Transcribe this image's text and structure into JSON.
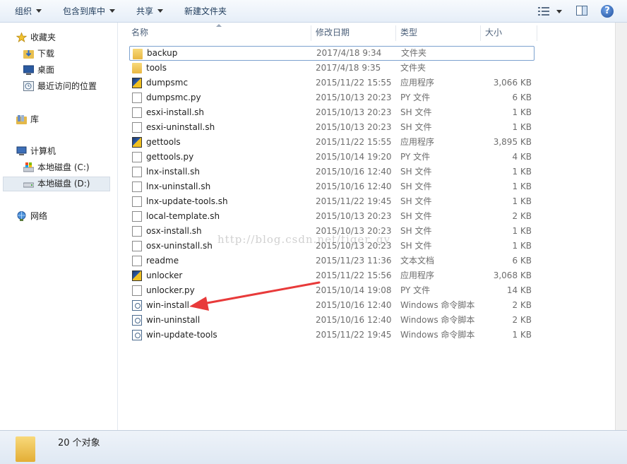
{
  "toolbar": {
    "organize": "组织",
    "include_library": "包含到库中",
    "share": "共享",
    "new_folder": "新建文件夹",
    "help": "?"
  },
  "nav": {
    "favorites": "收藏夹",
    "downloads": "下载",
    "desktop": "桌面",
    "recent": "最近访问的位置",
    "libraries": "库",
    "computer": "计算机",
    "drive_c": "本地磁盘 (C:)",
    "drive_d": "本地磁盘 (D:)",
    "network": "网络"
  },
  "columns": {
    "name": "名称",
    "date": "修改日期",
    "type": "类型",
    "size": "大小"
  },
  "files": [
    {
      "name": "backup",
      "date": "2017/4/18 9:34",
      "type": "文件夹",
      "size": "",
      "icon": "folder-icon"
    },
    {
      "name": "tools",
      "date": "2017/4/18 9:35",
      "type": "文件夹",
      "size": "",
      "icon": "folder-icon"
    },
    {
      "name": "dumpsmc",
      "date": "2015/11/22 15:55",
      "type": "应用程序",
      "size": "3,066 KB",
      "icon": "application-icon"
    },
    {
      "name": "dumpsmc.py",
      "date": "2015/10/13 20:23",
      "type": "PY 文件",
      "size": "6 KB",
      "icon": "document-icon"
    },
    {
      "name": "esxi-install.sh",
      "date": "2015/10/13 20:23",
      "type": "SH 文件",
      "size": "1 KB",
      "icon": "document-icon"
    },
    {
      "name": "esxi-uninstall.sh",
      "date": "2015/10/13 20:23",
      "type": "SH 文件",
      "size": "1 KB",
      "icon": "document-icon"
    },
    {
      "name": "gettools",
      "date": "2015/11/22 15:55",
      "type": "应用程序",
      "size": "3,895 KB",
      "icon": "application-icon"
    },
    {
      "name": "gettools.py",
      "date": "2015/10/14 19:20",
      "type": "PY 文件",
      "size": "4 KB",
      "icon": "document-icon"
    },
    {
      "name": "lnx-install.sh",
      "date": "2015/10/16 12:40",
      "type": "SH 文件",
      "size": "1 KB",
      "icon": "document-icon"
    },
    {
      "name": "lnx-uninstall.sh",
      "date": "2015/10/16 12:40",
      "type": "SH 文件",
      "size": "1 KB",
      "icon": "document-icon"
    },
    {
      "name": "lnx-update-tools.sh",
      "date": "2015/11/22 19:45",
      "type": "SH 文件",
      "size": "1 KB",
      "icon": "document-icon"
    },
    {
      "name": "local-template.sh",
      "date": "2015/10/13 20:23",
      "type": "SH 文件",
      "size": "2 KB",
      "icon": "document-icon"
    },
    {
      "name": "osx-install.sh",
      "date": "2015/10/13 20:23",
      "type": "SH 文件",
      "size": "1 KB",
      "icon": "document-icon"
    },
    {
      "name": "osx-uninstall.sh",
      "date": "2015/10/13 20:23",
      "type": "SH 文件",
      "size": "1 KB",
      "icon": "document-icon"
    },
    {
      "name": "readme",
      "date": "2015/11/23 11:36",
      "type": "文本文档",
      "size": "6 KB",
      "icon": "text-document-icon"
    },
    {
      "name": "unlocker",
      "date": "2015/11/22 15:56",
      "type": "应用程序",
      "size": "3,068 KB",
      "icon": "application-icon"
    },
    {
      "name": "unlocker.py",
      "date": "2015/10/14 19:08",
      "type": "PY 文件",
      "size": "14 KB",
      "icon": "document-icon"
    },
    {
      "name": "win-install",
      "date": "2015/10/16 12:40",
      "type": "Windows 命令脚本",
      "size": "2 KB",
      "icon": "batch-script-icon"
    },
    {
      "name": "win-uninstall",
      "date": "2015/10/16 12:40",
      "type": "Windows 命令脚本",
      "size": "2 KB",
      "icon": "batch-script-icon"
    },
    {
      "name": "win-update-tools",
      "date": "2015/11/22 19:45",
      "type": "Windows 命令脚本",
      "size": "1 KB",
      "icon": "batch-script-icon"
    }
  ],
  "status": {
    "count": "20 个对象"
  },
  "watermark": "http://blog.csdn.net/tiger_gy",
  "colors": {
    "selection_border": "#7da2ce",
    "annotation_arrow": "#e83a3a"
  }
}
